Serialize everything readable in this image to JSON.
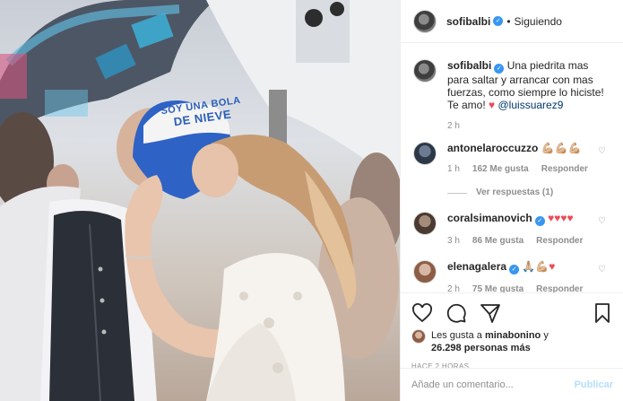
{
  "post": {
    "author": "sofibalbi",
    "follow_dot": "•",
    "follow_label": "Siguiendo",
    "photo_cap_text": [
      "SOY UNA BOLA",
      "DE NIEVE"
    ]
  },
  "caption": {
    "author": "sofibalbi",
    "text": "Una piedrita mas para saltar y arrancar con mas fuerzas, como siempre lo hiciste! Te amo!",
    "heart": "♥",
    "mention": "@luissuarez9",
    "age": "2 h"
  },
  "comments": [
    {
      "user": "antonelaroccuzzo",
      "text": "💪🏼💪🏼💪🏼",
      "age": "1 h",
      "likes": "162 Me gusta",
      "reply": "Responder",
      "replies": "Ver respuestas (1)"
    },
    {
      "user": "coralsimanovich",
      "text": "♥♥♥♥",
      "age": "3 h",
      "likes": "86 Me gusta",
      "reply": "Responder"
    },
    {
      "user": "elenagalera",
      "text_a": "🙏🏼💪🏼",
      "text_b": "♥",
      "age": "2 h",
      "likes": "75 Me gusta",
      "reply": "Responder"
    }
  ],
  "likes": {
    "prefix": "Les gusta a",
    "user": "minabonino",
    "middle": "y",
    "count": "26.298 personas más"
  },
  "timestamp": "HACE 2 HORAS",
  "add_comment": {
    "placeholder": "Añade un comentario...",
    "publish": "Publicar"
  },
  "colors": {
    "verified": "#3897f0",
    "heart": "#ed4956",
    "publish_disabled": "#b2dffc",
    "cap_blue": "#2c5fb8"
  }
}
